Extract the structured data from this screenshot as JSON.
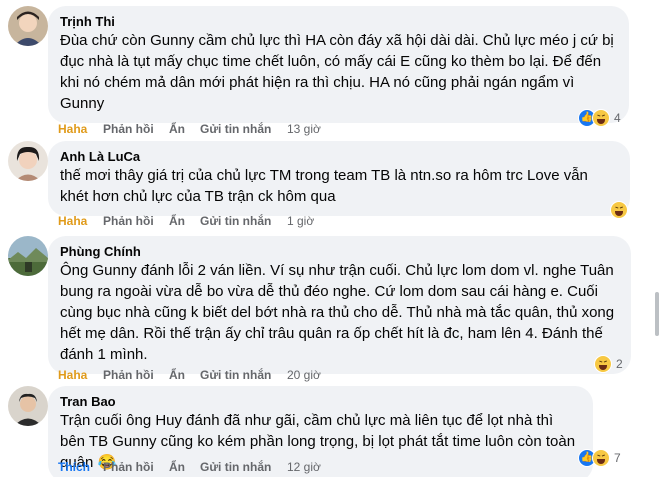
{
  "comments": [
    {
      "author": "Trịnh Thi",
      "text": "Đùa chứ còn Gunny cầm chủ lực thì HA còn đáy xã hội dài dài. Chủ lực méo j cứ bị đục nhà là tụt mấy chục time chết luôn, có mấy cái E cũng ko thèm bo lại. Để đến khi nó chém mả dân mới phát hiện ra thì chịu. HA nó cũng phải ngán ngẩm vì Gunny",
      "reaction_label": "Haha",
      "reply_label": "Phản hồi",
      "hide_label": "Ẩn",
      "message_label": "Gửi tin nhắn",
      "time": "13 giờ",
      "reaction_count": "4",
      "reaction_icons": [
        "like-icon",
        "haha-icon"
      ]
    },
    {
      "author": "Anh Là LuCa",
      "text": "thế mơi thây giá trị của chủ lực TM trong team TB là ntn.so ra hôm trc Love vẫn khét hơn chủ lực của TB trận ck hôm qua",
      "reaction_label": "Haha",
      "reply_label": "Phản hồi",
      "hide_label": "Ẩn",
      "message_label": "Gửi tin nhắn",
      "time": "1 giờ",
      "reaction_count": "",
      "reaction_icons": [
        "haha-icon"
      ]
    },
    {
      "author": "Phùng Chính",
      "text": "Ông Gunny đánh lỗi 2 ván liền. Ví sụ như trận cuối. Chủ lực lom dom vl. nghe Tuân bung ra ngoài vừa dễ bo vừa dễ thủ đéo nghe. Cứ lom dom sau cái hàng e. Cuối cùng bục nhà cũng k biết del bớt nhà ra thủ cho dễ. Thủ nhà mà tắc quân, thủ xong hết mẹ dân. Rồi thế trận ấy chỉ trâu quân ra ốp chết hít là đc, ham lên 4. Đánh thế đánh 1 mình.",
      "reaction_label": "Haha",
      "reply_label": "Phản hồi",
      "hide_label": "Ẩn",
      "message_label": "Gửi tin nhắn",
      "time": "20 giờ",
      "reaction_count": "2",
      "reaction_icons": [
        "haha-icon"
      ]
    },
    {
      "author": "Tran Bao",
      "text": "Trận cuối ông Huy đánh đã như gãi, cầm chủ lực mà liên tục để lọt nhà thì bên TB Gunny cũng ko kém phần long trọng, bị lọt phát tắt time luôn còn toàn quân 😂",
      "reaction_label": "Thích",
      "reply_label": "Phản hồi",
      "hide_label": "Ẩn",
      "message_label": "Gửi tin nhắn",
      "time": "12 giờ",
      "reaction_count": "7",
      "reaction_icons": [
        "like-icon",
        "haha-icon"
      ]
    }
  ],
  "colors": {
    "bubble_bg": "#f0f2f5",
    "haha_label": "#e09b1b",
    "like_blue": "#1877f2",
    "meta_gray": "#65676b"
  }
}
